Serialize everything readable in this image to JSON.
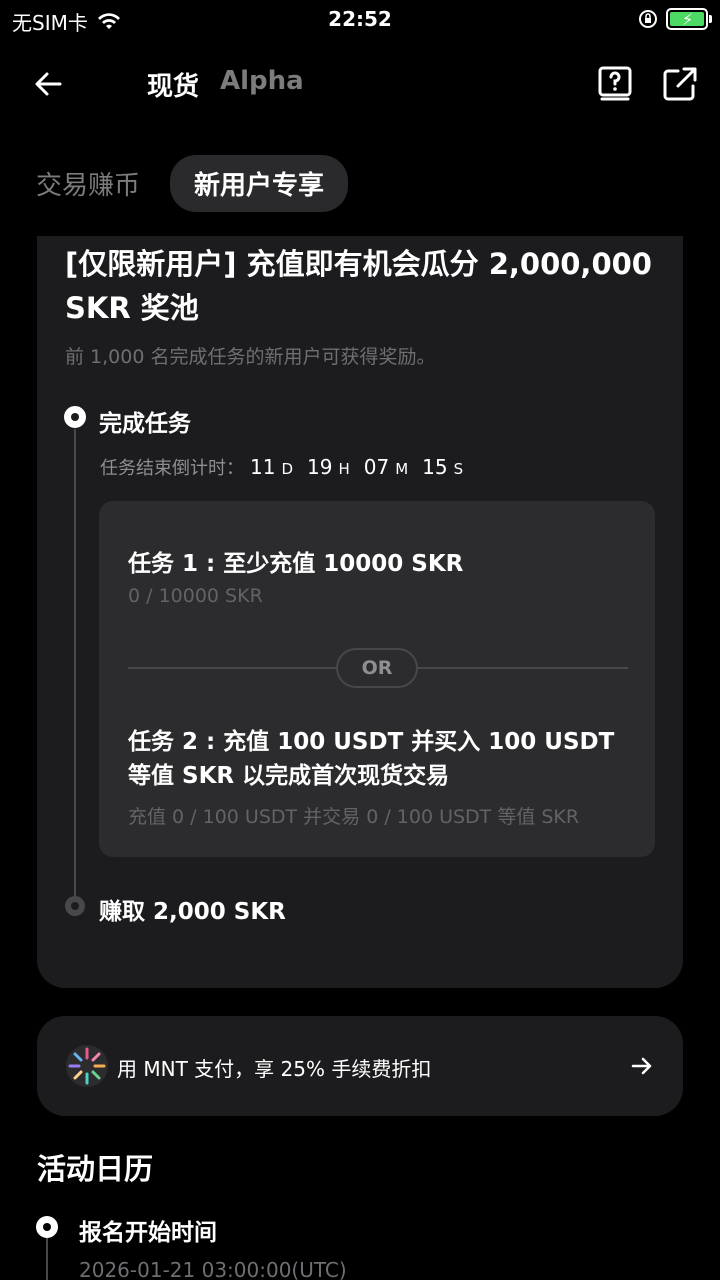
{
  "status_bar": {
    "carrier": "无SIM卡",
    "time": "22:52"
  },
  "header": {
    "tab_spot": "现货",
    "tab_alpha": "Alpha"
  },
  "subtabs": {
    "trade_earn": "交易赚币",
    "new_user": "新用户专享"
  },
  "card": {
    "title": "[仅限新用户] 充值即有机会瓜分 2,000,000 SKR 奖池",
    "description": "前 1,000 名完成任务的新用户可获得奖励。",
    "step1": "完成任务",
    "countdown_label": "任务结束倒计时：",
    "countdown": {
      "days": "11",
      "days_unit": "D",
      "hours": "19",
      "hours_unit": "H",
      "minutes": "07",
      "minutes_unit": "M",
      "seconds": "15",
      "seconds_unit": "S"
    },
    "task1_title": "任务 1 : 至少充值 10000 SKR",
    "task1_progress": "0 / 10000 SKR",
    "or_label": "OR",
    "task2_title": "任务 2 : 充值 100 USDT 并买入 100 USDT 等值 SKR 以完成首次现货交易",
    "task2_progress": "充值 0 / 100 USDT 并交易 0 / 100 USDT 等值 SKR",
    "step2": "赚取 2,000 SKR"
  },
  "promo": {
    "text": "用 MNT 支付，享 25% 手续费折扣",
    "logo_icon": "mnt-logo-icon"
  },
  "calendar": {
    "title": "活动日历",
    "item1_label": "报名开始时间",
    "item1_date": "2026-01-21 03:00:00(UTC)"
  }
}
